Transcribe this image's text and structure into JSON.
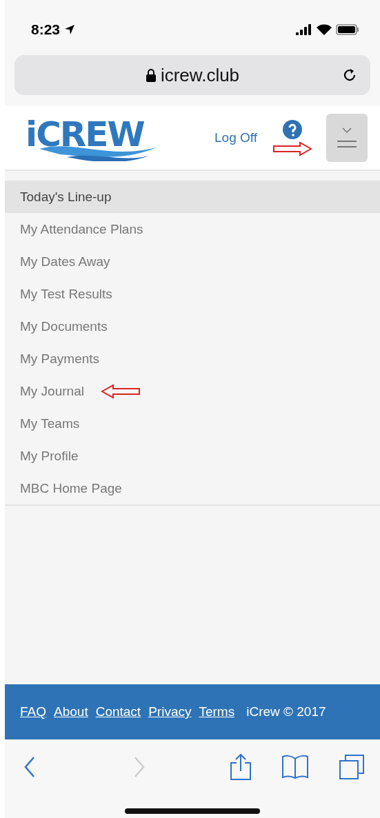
{
  "status_bar": {
    "time": "8:23"
  },
  "browser": {
    "url": "icrew.club"
  },
  "header": {
    "logo": "iCREW",
    "logoff": "Log Off"
  },
  "menu": {
    "items": [
      {
        "label": "Today's Line-up",
        "selected": true
      },
      {
        "label": "My Attendance Plans",
        "selected": false
      },
      {
        "label": "My Dates Away",
        "selected": false
      },
      {
        "label": "My Test Results",
        "selected": false
      },
      {
        "label": "My Documents",
        "selected": false
      },
      {
        "label": "My Payments",
        "selected": false
      },
      {
        "label": "My Journal",
        "selected": false
      },
      {
        "label": "My Teams",
        "selected": false
      },
      {
        "label": "My Profile",
        "selected": false
      },
      {
        "label": "MBC Home Page",
        "selected": false
      }
    ]
  },
  "footer": {
    "links": [
      "FAQ",
      "About",
      "Contact",
      "Privacy",
      "Terms"
    ],
    "copyright": "iCrew © 2017"
  }
}
